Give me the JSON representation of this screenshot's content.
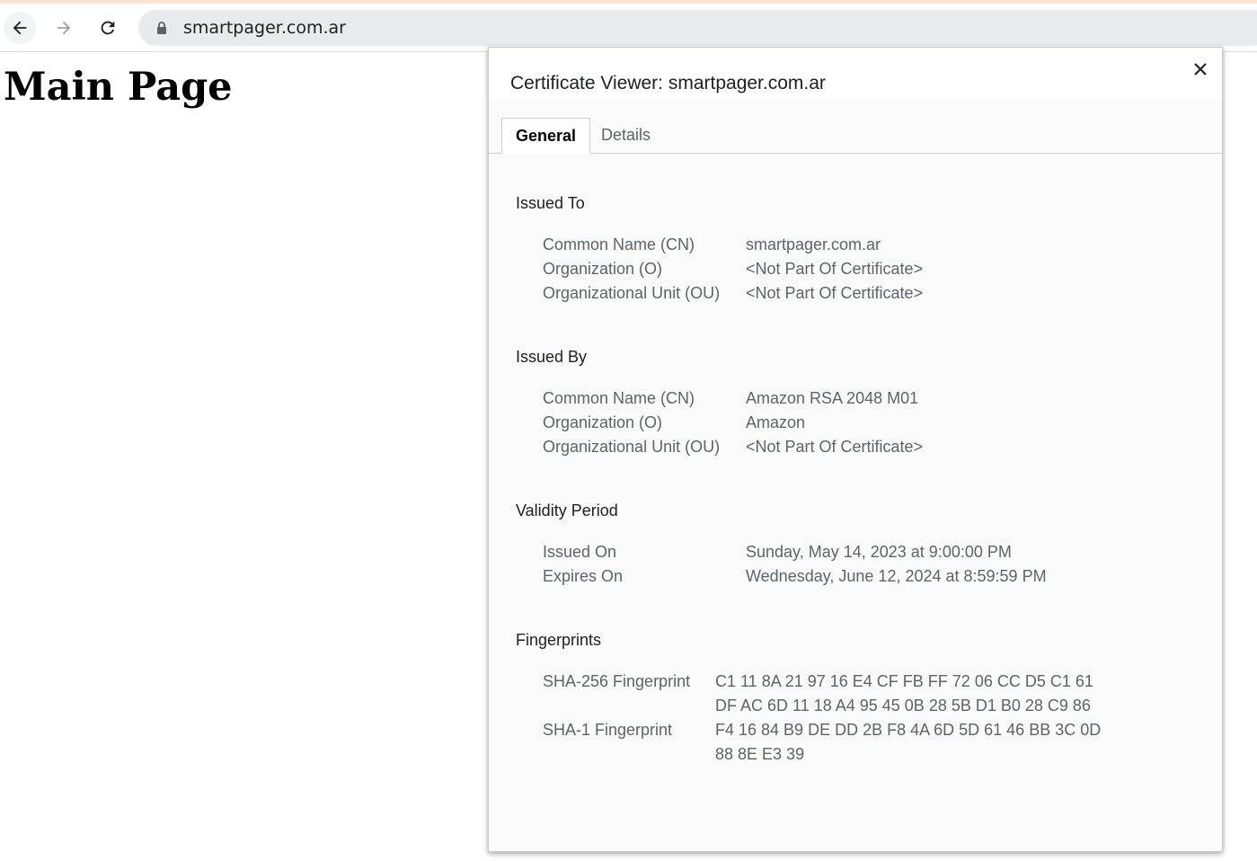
{
  "browser": {
    "url": "smartpager.com.ar"
  },
  "page": {
    "heading": "Main Page"
  },
  "dialog": {
    "title": "Certificate Viewer: smartpager.com.ar",
    "tabs": [
      {
        "label": "General",
        "selected": true
      },
      {
        "label": "Details",
        "selected": false
      }
    ],
    "issued_to": {
      "title": "Issued To",
      "rows": [
        {
          "label": "Common Name (CN)",
          "value": "smartpager.com.ar"
        },
        {
          "label": "Organization (O)",
          "value": "<Not Part Of Certificate>"
        },
        {
          "label": "Organizational Unit (OU)",
          "value": "<Not Part Of Certificate>"
        }
      ]
    },
    "issued_by": {
      "title": "Issued By",
      "rows": [
        {
          "label": "Common Name (CN)",
          "value": "Amazon RSA 2048 M01"
        },
        {
          "label": "Organization (O)",
          "value": "Amazon"
        },
        {
          "label": "Organizational Unit (OU)",
          "value": "<Not Part Of Certificate>"
        }
      ]
    },
    "validity": {
      "title": "Validity Period",
      "rows": [
        {
          "label": "Issued On",
          "value": "Sunday, May 14, 2023 at 9:00:00 PM"
        },
        {
          "label": "Expires On",
          "value": "Wednesday, June 12, 2024 at 8:59:59 PM"
        }
      ]
    },
    "fingerprints": {
      "title": "Fingerprints",
      "sha256": {
        "label": "SHA-256 Fingerprint",
        "line1": "C1 11 8A 21 97 16 E4 CF FB FF 72 06 CC D5 C1 61",
        "line2": "DF AC 6D 11 18 A4 95 45 0B 28 5B D1 B0 28 C9 86"
      },
      "sha1": {
        "label": "SHA-1 Fingerprint",
        "line1": "F4 16 84 B9 DE DD 2B F8 4A 6D 5D 61 46 BB 3C 0D",
        "line2": "88 8E E3 39"
      }
    }
  },
  "icons": {
    "back": "back-arrow-icon",
    "forward": "forward-arrow-icon",
    "reload": "reload-icon",
    "lock": "lock-icon",
    "close": "close-icon"
  }
}
